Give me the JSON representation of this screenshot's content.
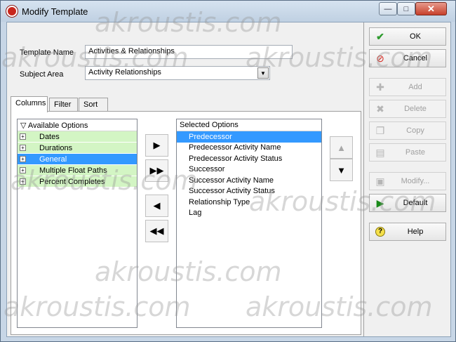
{
  "window": {
    "title": "Modify Template"
  },
  "form": {
    "template_name_label": "Template Name",
    "template_name_value": "Activities & Relationships",
    "subject_area_label": "Subject Area",
    "subject_area_value": "Activity Relationships"
  },
  "tabs": [
    {
      "label": "Columns"
    },
    {
      "label": "Filter"
    },
    {
      "label": "Sort"
    }
  ],
  "available": {
    "header": "Available Options",
    "items": [
      {
        "label": "Dates"
      },
      {
        "label": "Durations"
      },
      {
        "label": "General"
      },
      {
        "label": "Multiple Float Paths"
      },
      {
        "label": "Percent Completes"
      }
    ]
  },
  "selected": {
    "header": "Selected Options",
    "items": [
      {
        "label": "Predecessor"
      },
      {
        "label": "Predecessor Activity Name"
      },
      {
        "label": "Predecessor Activity Status"
      },
      {
        "label": "Successor"
      },
      {
        "label": "Successor Activity Name"
      },
      {
        "label": "Successor Activity Status"
      },
      {
        "label": "Relationship Type"
      },
      {
        "label": "Lag"
      }
    ]
  },
  "buttons": {
    "ok": "OK",
    "cancel": "Cancel",
    "add": "Add",
    "delete": "Delete",
    "copy": "Copy",
    "paste": "Paste",
    "modify": "Modify...",
    "default": "Default",
    "help": "Help"
  },
  "watermark": "akroustis.com",
  "colors": {
    "selection": "#3399ff",
    "tree_bg": "#d3f5c4",
    "ok_check": "#2e9b2e",
    "cancel_red": "#d7261e"
  }
}
